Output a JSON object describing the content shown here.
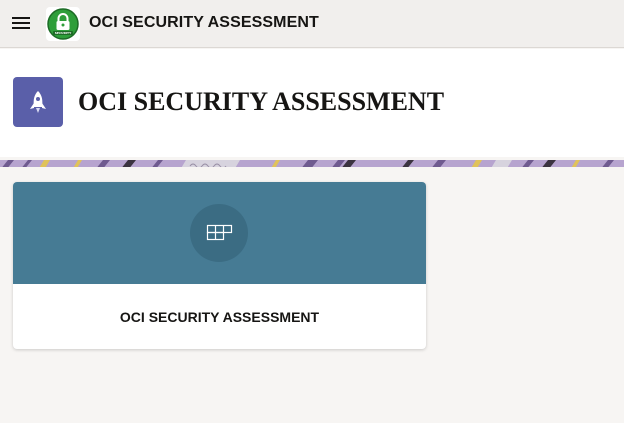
{
  "topbar": {
    "title": "OCI SECURITY ASSESSMENT",
    "menu_icon": "hamburger-menu-icon",
    "logo_icon": "padlock-security-badge-icon",
    "logo_text": "SECURITY"
  },
  "header": {
    "title": "OCI SECURITY ASSESSMENT",
    "icon": "rocket-icon"
  },
  "cards": [
    {
      "label": "OCI SECURITY ASSESSMENT",
      "icon": "grid-icon"
    }
  ],
  "colors": {
    "topbar_bg": "#f1efed",
    "header_icon_bg": "#5a5fa9",
    "card_banner_bg": "#467b94",
    "logo_green": "#2e9e3a",
    "page_bg": "#f7f5f3"
  }
}
